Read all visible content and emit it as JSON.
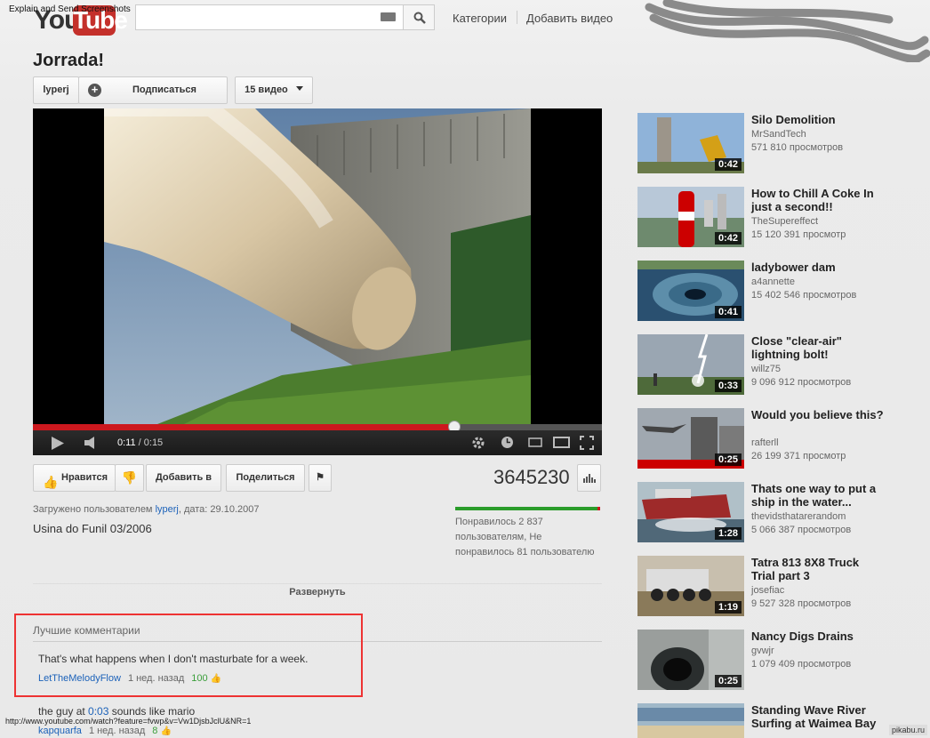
{
  "watermark": "Explain and Send Screenshots",
  "logo": {
    "you": "You",
    "tube": "Tube"
  },
  "search": {
    "placeholder": ""
  },
  "nav": {
    "categories": "Категории",
    "add_video": "Добавить видео"
  },
  "video": {
    "title": "Jorrada!",
    "channel": "lyperj",
    "subscribe": "Подписаться",
    "video_count": "15 видео",
    "time_current": "0:11",
    "time_total": "/ 0:15",
    "progress": 0.74,
    "views": "3645230",
    "uploaded_prefix": "Загружено пользователем",
    "uploader": "lyperj",
    "date_text": ", дата: 29.10.2007",
    "description": "Usina do Funil 03/2006",
    "likes_line1": "Понравилось 2 837",
    "likes_line2": "пользователям, Не",
    "likes_line3": "понравилось 81 пользователю"
  },
  "actions": {
    "like": "Нравится",
    "add_to": "Добавить в",
    "share": "Поделиться"
  },
  "expand": "Развернуть",
  "comments": {
    "heading": "Лучшие комментарии",
    "items": [
      {
        "text": "That's what happens when I don't masturbate for a week.",
        "author": "LetTheMelodyFlow",
        "ago": "1 нед. назад",
        "score": "100"
      },
      {
        "text_pre": "the guy at ",
        "time_link": "0:03",
        "text_post": " sounds like mario",
        "author": "kapquarfa",
        "ago": "1 нед. назад",
        "score": "8"
      }
    ]
  },
  "status_url": "http://www.youtube.com/watch?feature=fvwp&v=Vw1DjsbJclU&NR=1",
  "related": [
    {
      "title": "Silo Demolition",
      "author": "MrSandTech",
      "views": "571 810 просмотров",
      "duration": "0:42",
      "thumb": "silo"
    },
    {
      "title": "How to Chill A Coke In just a second!!",
      "author": "TheSupereffect",
      "views": "15 120 391 просмотр",
      "duration": "0:42",
      "thumb": "coke"
    },
    {
      "title": "ladybower dam",
      "author": "a4annette",
      "views": "15 402 546 просмотров",
      "duration": "0:41",
      "thumb": "dam"
    },
    {
      "title": "Close \"clear-air\" lightning bolt!",
      "author": "willz75",
      "views": "9 096 912 просмотров",
      "duration": "0:33",
      "thumb": "lightning"
    },
    {
      "title": "Would you believe this?",
      "author": "rafterll",
      "views": "26 199 371 просмотр",
      "duration": "0:25",
      "thumb": "jet"
    },
    {
      "title": "Thats one way to put a ship in the water...",
      "author": "thevidsthatarerandom",
      "views": "5 066 387 просмотров",
      "duration": "1:28",
      "thumb": "ship"
    },
    {
      "title": "Tatra 813 8X8 Truck Trial part 3",
      "author": "josefiac",
      "views": "9 527 328 просмотров",
      "duration": "1:19",
      "thumb": "truck"
    },
    {
      "title": "Nancy Digs Drains",
      "author": "gvwjr",
      "views": "1 079 409 просмотров",
      "duration": "0:25",
      "thumb": "drain"
    },
    {
      "title": "Standing Wave River Surfing at Waimea Bay",
      "author": "",
      "views": "",
      "duration": "",
      "thumb": "beach"
    }
  ],
  "pikabu": "pikabu.ru"
}
